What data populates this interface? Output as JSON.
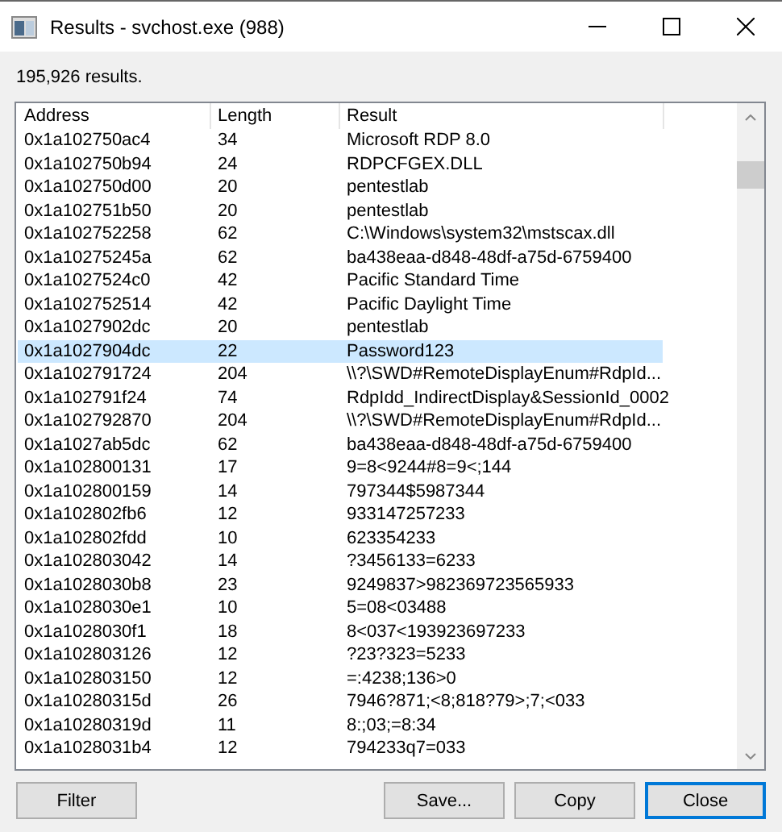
{
  "window": {
    "title": "Results - svchost.exe (988)"
  },
  "summary": "195,926 results.",
  "table": {
    "columns": [
      "Address",
      "Length",
      "Result"
    ],
    "rows": [
      {
        "address": "0x1a102750ac4",
        "length": "34",
        "result": "Microsoft RDP 8.0",
        "selected": false
      },
      {
        "address": "0x1a102750b94",
        "length": "24",
        "result": "RDPCFGEX.DLL",
        "selected": false
      },
      {
        "address": "0x1a102750d00",
        "length": "20",
        "result": "pentestlab",
        "selected": false
      },
      {
        "address": "0x1a102751b50",
        "length": "20",
        "result": "pentestlab",
        "selected": false
      },
      {
        "address": "0x1a102752258",
        "length": "62",
        "result": "C:\\Windows\\system32\\mstscax.dll",
        "selected": false
      },
      {
        "address": "0x1a10275245a",
        "length": "62",
        "result": "ba438eaa-d848-48df-a75d-6759400",
        "selected": false
      },
      {
        "address": "0x1a1027524c0",
        "length": "42",
        "result": "Pacific Standard Time",
        "selected": false
      },
      {
        "address": "0x1a102752514",
        "length": "42",
        "result": "Pacific Daylight Time",
        "selected": false
      },
      {
        "address": "0x1a1027902dc",
        "length": "20",
        "result": "pentestlab",
        "selected": false
      },
      {
        "address": "0x1a1027904dc",
        "length": "22",
        "result": "Password123",
        "selected": true
      },
      {
        "address": "0x1a102791724",
        "length": "204",
        "result": "\\\\?\\SWD#RemoteDisplayEnum#RdpId...",
        "selected": false
      },
      {
        "address": "0x1a102791f24",
        "length": "74",
        "result": "RdpIdd_IndirectDisplay&SessionId_0002",
        "selected": false
      },
      {
        "address": "0x1a102792870",
        "length": "204",
        "result": "\\\\?\\SWD#RemoteDisplayEnum#RdpId...",
        "selected": false
      },
      {
        "address": "0x1a1027ab5dc",
        "length": "62",
        "result": "ba438eaa-d848-48df-a75d-6759400",
        "selected": false
      },
      {
        "address": "0x1a102800131",
        "length": "17",
        "result": "9=8<9244#8=9<;144",
        "selected": false
      },
      {
        "address": "0x1a102800159",
        "length": "14",
        "result": "797344$5987344",
        "selected": false
      },
      {
        "address": "0x1a102802fb6",
        "length": "12",
        "result": "933147257233",
        "selected": false
      },
      {
        "address": "0x1a102802fdd",
        "length": "10",
        "result": "623354233",
        "selected": false
      },
      {
        "address": "0x1a102803042",
        "length": "14",
        "result": "?3456133=6233",
        "selected": false
      },
      {
        "address": "0x1a1028030b8",
        "length": "23",
        "result": "9249837>982369723565933",
        "selected": false
      },
      {
        "address": "0x1a1028030e1",
        "length": "10",
        "result": "5=08<03488",
        "selected": false
      },
      {
        "address": "0x1a1028030f1",
        "length": "18",
        "result": "8<037<193923697233",
        "selected": false
      },
      {
        "address": "0x1a102803126",
        "length": "12",
        "result": "?23?323=5233",
        "selected": false
      },
      {
        "address": "0x1a102803150",
        "length": "12",
        "result": "=:4238;136>0",
        "selected": false
      },
      {
        "address": "0x1a10280315d",
        "length": "26",
        "result": "7946?871;<8;818?79>;7;<033",
        "selected": false
      },
      {
        "address": "0x1a10280319d",
        "length": "11",
        "result": "8:;03;=8:34",
        "selected": false
      },
      {
        "address": "0x1a1028031b4",
        "length": "12",
        "result": "794233q7=033",
        "selected": false
      }
    ]
  },
  "buttons": [
    {
      "label": "Filter",
      "kind": "left",
      "default": false
    },
    {
      "label": "Save...",
      "kind": "right",
      "default": false
    },
    {
      "label": "Copy",
      "kind": "right",
      "default": false
    },
    {
      "label": "Close",
      "kind": "right",
      "default": true
    }
  ]
}
